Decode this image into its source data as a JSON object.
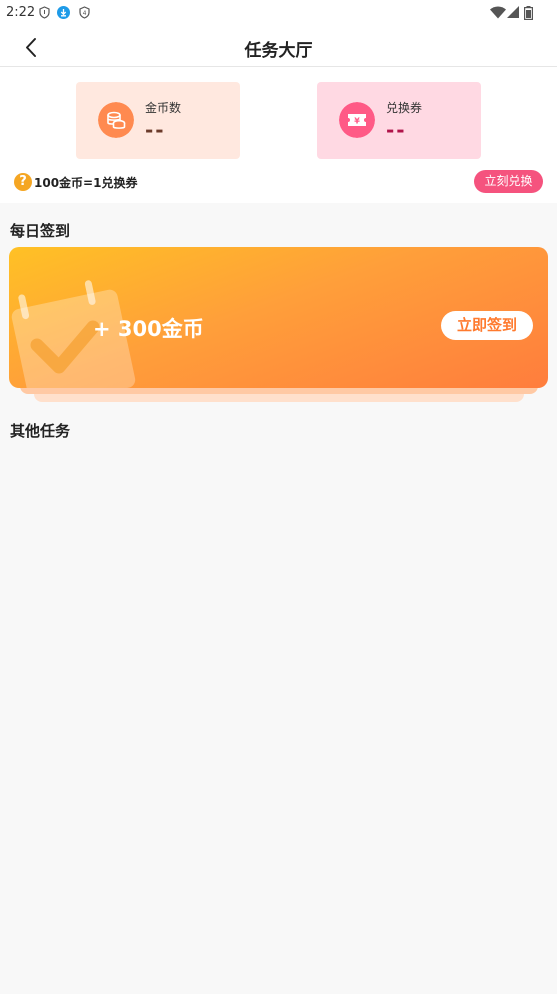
{
  "status_bar": {
    "time": "2:22",
    "icons": [
      "shield-icon",
      "download-icon",
      "badge-icon",
      "wifi-icon",
      "signal-icon",
      "battery-icon"
    ]
  },
  "nav": {
    "title": "任务大厅",
    "back_icon": "chevron-left-icon"
  },
  "stats": {
    "coins": {
      "label": "金币数",
      "value": "--",
      "icon": "coins-icon",
      "color": "#ff8a50"
    },
    "vouchers": {
      "label": "兑换券",
      "value": "--",
      "icon": "ticket-icon",
      "color": "#ff5a86"
    }
  },
  "exchange": {
    "rate_text": "100金币=1兑换券",
    "rate_icon_glyph": "?",
    "button_label": "立刻兑换"
  },
  "daily": {
    "section_title": "每日签到",
    "reward_text": "+ 300金币",
    "button_label": "立即签到"
  },
  "other": {
    "section_title": "其他任务"
  },
  "colors": {
    "accent_pink": "#f5537e",
    "accent_orange": "#ff7a2e",
    "coin_card_bg": "#ffe8df",
    "voucher_card_bg": "#ffd9e3"
  }
}
